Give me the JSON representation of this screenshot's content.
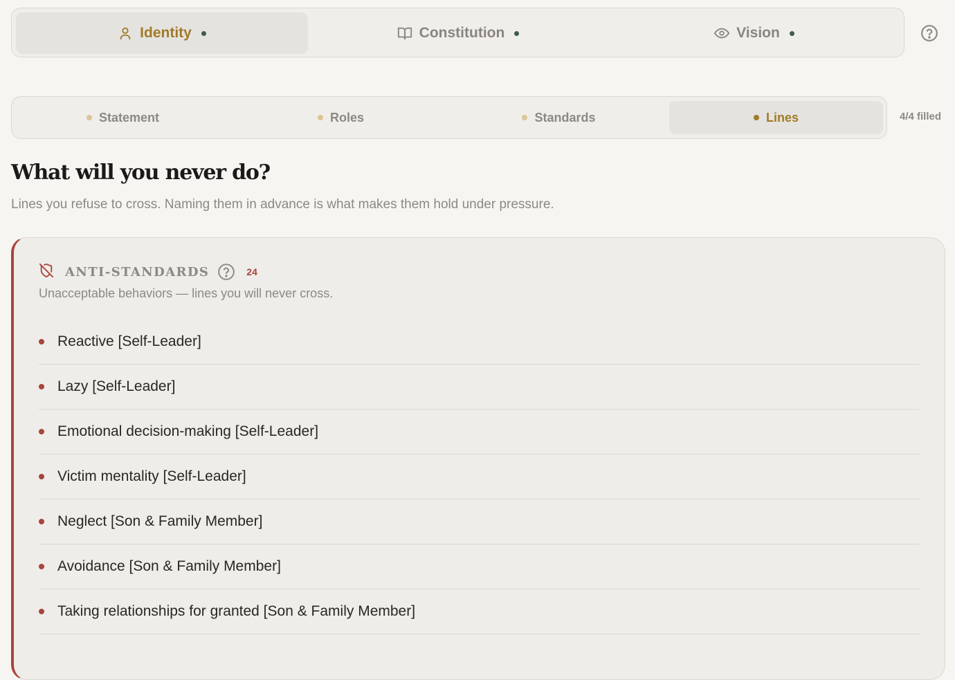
{
  "top_tabs": [
    {
      "label": "Identity",
      "icon": "person-icon",
      "active": true,
      "status_color": "#3f5c4a"
    },
    {
      "label": "Constitution",
      "icon": "book-icon",
      "active": false,
      "status_color": "#3f5c4a"
    },
    {
      "label": "Vision",
      "icon": "eye-icon",
      "active": false,
      "status_color": "#3f5c4a"
    }
  ],
  "help_icon": "help-circle-icon",
  "sub_tabs": [
    {
      "label": "Statement",
      "active": false
    },
    {
      "label": "Roles",
      "active": false
    },
    {
      "label": "Standards",
      "active": false
    },
    {
      "label": "Lines",
      "active": true
    }
  ],
  "progress": {
    "label": "4/4 filled",
    "filled": 4,
    "total": 4
  },
  "page": {
    "title": "What will you never do?",
    "subtitle": "Lines you refuse to cross. Naming them in advance is what makes them hold under pressure."
  },
  "card": {
    "icon": "shield-off-icon",
    "title": "ANTI-STANDARDS",
    "count": "24",
    "description": "Unacceptable behaviors — lines you will never cross.",
    "accent_color": "#a8453a",
    "items": [
      "Reactive [Self-Leader]",
      "Lazy [Self-Leader]",
      "Emotional decision-making [Self-Leader]",
      "Victim mentality [Self-Leader]",
      "Neglect [Son & Family Member]",
      "Avoidance [Son & Family Member]",
      "Taking relationships for granted [Son & Family Member]"
    ]
  },
  "colors": {
    "accent_gold": "#a07a28",
    "accent_red": "#a8453a",
    "background": "#f7f5f2"
  }
}
